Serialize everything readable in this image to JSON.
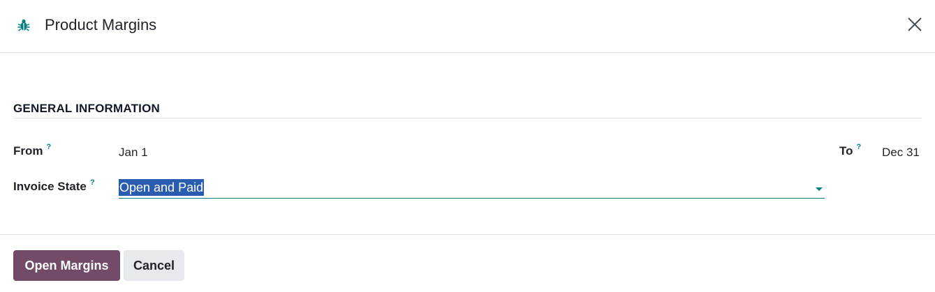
{
  "dialog": {
    "title": "Product Margins",
    "close_icon": "close-icon",
    "debug_icon": "bug-icon"
  },
  "section": {
    "title": "GENERAL INFORMATION"
  },
  "fields": {
    "from": {
      "label": "From",
      "help": "?",
      "value": "Jan 1"
    },
    "to": {
      "label": "To",
      "help": "?",
      "value": "Dec 31"
    },
    "invoice_state": {
      "label": "Invoice State",
      "help": "?",
      "value": "Open and Paid"
    }
  },
  "footer": {
    "primary_label": "Open Margins",
    "cancel_label": "Cancel"
  },
  "colors": {
    "accent": "#017e84",
    "primary_button": "#714b67",
    "selection": "#2a5db0"
  }
}
